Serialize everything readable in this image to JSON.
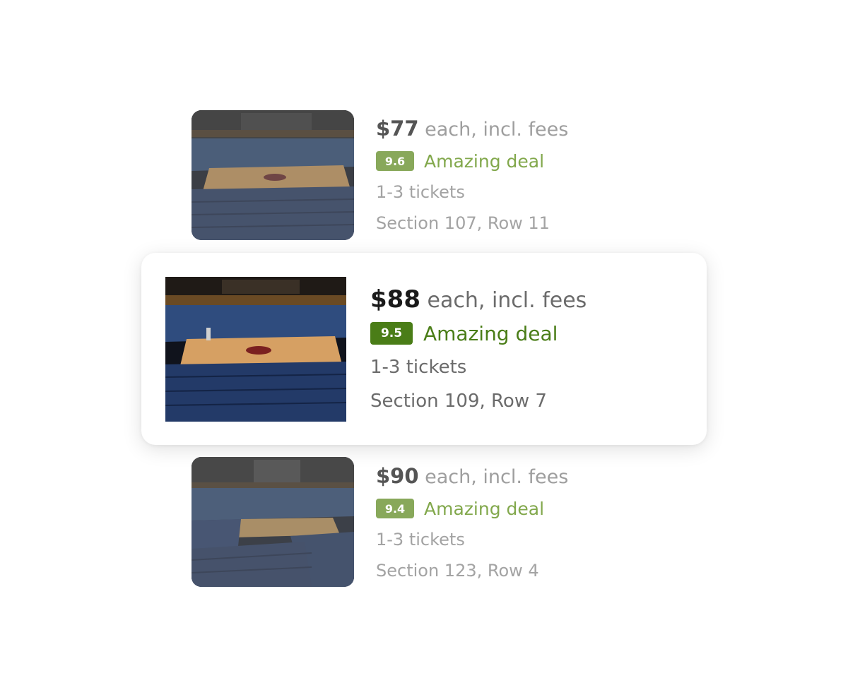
{
  "listings": [
    {
      "price": "$77",
      "price_suffix": "each, incl. fees",
      "score": "9.6",
      "deal_label": "Amazing deal",
      "tickets": "1-3 tickets",
      "location": "Section 107, Row 11",
      "image": "arena-court-view-icon"
    },
    {
      "price": "$88",
      "price_suffix": "each, incl. fees",
      "score": "9.5",
      "deal_label": "Amazing deal",
      "tickets": "1-3 tickets",
      "location": "Section 109, Row 7",
      "image": "arena-court-view-icon",
      "selected": true
    },
    {
      "price": "$90",
      "price_suffix": "each, incl. fees",
      "score": "9.4",
      "deal_label": "Amazing deal",
      "tickets": "1-3 tickets",
      "location": "Section 123, Row 4",
      "image": "arena-court-view-icon"
    }
  ],
  "colors": {
    "deal_green": "#4a7d17",
    "deal_green_dim": "#88a85a",
    "card_bg": "#ffffff"
  }
}
